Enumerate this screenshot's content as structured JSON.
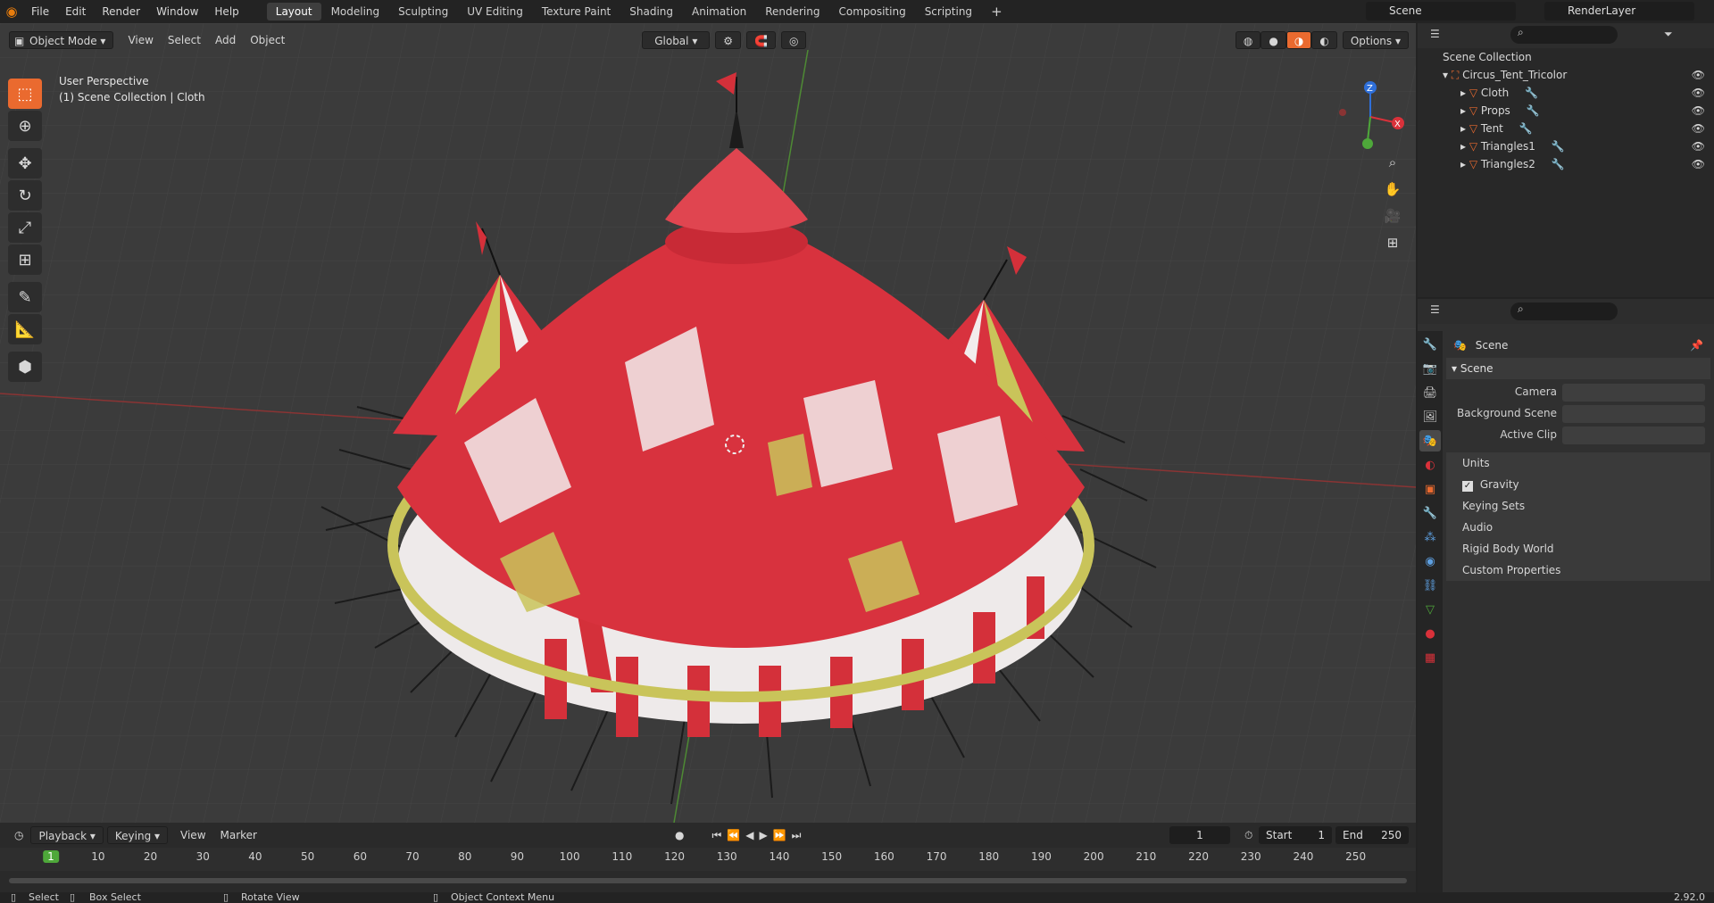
{
  "menu": {
    "file": "File",
    "edit": "Edit",
    "render": "Render",
    "window": "Window",
    "help": "Help"
  },
  "workspaces": [
    {
      "label": "Layout",
      "active": true
    },
    {
      "label": "Modeling",
      "active": false
    },
    {
      "label": "Sculpting",
      "active": false
    },
    {
      "label": "UV Editing",
      "active": false
    },
    {
      "label": "Texture Paint",
      "active": false
    },
    {
      "label": "Shading",
      "active": false
    },
    {
      "label": "Animation",
      "active": false
    },
    {
      "label": "Rendering",
      "active": false
    },
    {
      "label": "Compositing",
      "active": false
    },
    {
      "label": "Scripting",
      "active": false
    }
  ],
  "topright": {
    "scene": "Scene",
    "view_layer": "RenderLayer"
  },
  "viewport": {
    "mode": "Object Mode",
    "menus": {
      "view": "View",
      "select": "Select",
      "add": "Add",
      "object": "Object"
    },
    "orientation": "Global",
    "options": "Options",
    "perspective_label": "User Perspective",
    "collection_label": "(1) Scene Collection | Cloth",
    "gizmo": {
      "z": "Z",
      "x": "X"
    }
  },
  "outliner": {
    "root": "Scene Collection",
    "collection": "Circus_Tent_Tricolor",
    "objects": [
      "Cloth",
      "Props",
      "Tent",
      "Triangles1",
      "Triangles2"
    ]
  },
  "properties": {
    "context": "Scene",
    "panel": "Scene",
    "camera_label": "Camera",
    "background_scene_label": "Background Scene",
    "active_clip_label": "Active Clip",
    "subpanels": [
      "Units",
      "Gravity",
      "Keying Sets",
      "Audio",
      "Rigid Body World",
      "Custom Properties"
    ],
    "gravity_checked": true
  },
  "timeline": {
    "playback": "Playback",
    "keying": "Keying",
    "view": "View",
    "marker": "Marker",
    "current_frame": "1",
    "start_label": "Start",
    "start": "1",
    "end_label": "End",
    "end": "250",
    "ticks": [
      "1",
      "10",
      "20",
      "30",
      "40",
      "50",
      "60",
      "70",
      "80",
      "90",
      "100",
      "110",
      "120",
      "130",
      "140",
      "150",
      "160",
      "170",
      "180",
      "190",
      "200",
      "210",
      "220",
      "230",
      "240",
      "250"
    ]
  },
  "statusbar": {
    "select": "Select",
    "box_select": "Box Select",
    "rotate_view": "Rotate View",
    "context_menu": "Object Context Menu",
    "version": "2.92.0"
  },
  "colors": {
    "accent": "#ea6a2f",
    "tent_red": "#d8323e",
    "tent_yellow": "#c9c45a",
    "tent_white": "#f2ecec"
  }
}
